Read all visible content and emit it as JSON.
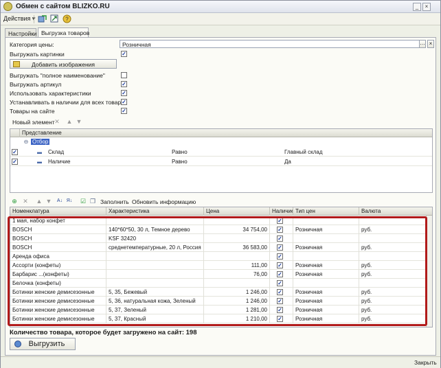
{
  "window": {
    "title": "Обмен с сайтом BLIZKO.RU"
  },
  "toolbar": {
    "actions_label": "Действия ▾"
  },
  "tabs": [
    {
      "label": "Настройки"
    },
    {
      "label": "Выгрузка товаров"
    }
  ],
  "settings": {
    "price_category_label": "Категория цены:",
    "price_category_value": "Розничная",
    "export_images_label": "Выгружать картинки",
    "add_images_button": "Добавить изображения",
    "export_full_name_label": "Выгружать \"полное наименование\"",
    "export_article_label": "Выгружать артикул",
    "use_characteristics_label": "Использовать характеристики",
    "set_in_stock_label": "Устанавливать в наличии для всех товаров",
    "goods_on_site_label": "Товары на сайте"
  },
  "filter": {
    "new_element_label": "Новый элемент",
    "column_header": "Представление",
    "group_label": "Отбор",
    "rows": [
      {
        "field": "Склад",
        "condition": "Равно",
        "value": "Главный склад"
      },
      {
        "field": "Наличие",
        "condition": "Равно",
        "value": "Да"
      }
    ]
  },
  "goods_toolbar": {
    "fill_label": "Заполнить",
    "update_info_label": "Обновить информацию"
  },
  "goods": {
    "columns": [
      "Номенклатура",
      "Характеристика",
      "Цена",
      "Наличие",
      "Тип цен",
      "Валюта"
    ],
    "rows": [
      {
        "name": "1 мая, набор конфет",
        "char": "",
        "price": "",
        "stock": true,
        "price_type": "",
        "currency": ""
      },
      {
        "name": "BOSCH",
        "char": "140*60*50, 30 л, Темное дерево",
        "price": "34 754,00",
        "stock": true,
        "price_type": "Розничная",
        "currency": "руб."
      },
      {
        "name": "BOSCH",
        "char": "KSF 32420",
        "price": "",
        "stock": true,
        "price_type": "",
        "currency": ""
      },
      {
        "name": "BOSCH",
        "char": "среднетемпературные, 20 л, Россия",
        "price": "36 583,00",
        "stock": true,
        "price_type": "Розничная",
        "currency": "руб."
      },
      {
        "name": "Аренда офиса",
        "char": "",
        "price": "",
        "stock": true,
        "price_type": "",
        "currency": ""
      },
      {
        "name": "Ассорти (конфеты)",
        "char": "",
        "price": "111,00",
        "stock": true,
        "price_type": "Розничная",
        "currency": "руб."
      },
      {
        "name": "Барбарис ...(конфеты)",
        "char": "",
        "price": "76,00",
        "stock": true,
        "price_type": "Розничная",
        "currency": "руб."
      },
      {
        "name": "Белочка (конфеты)",
        "char": "",
        "price": "",
        "stock": true,
        "price_type": "",
        "currency": ""
      },
      {
        "name": "Ботинки женские демисезонные",
        "char": "5, 35, Бежевый",
        "price": "1 246,00",
        "stock": true,
        "price_type": "Розничная",
        "currency": "руб."
      },
      {
        "name": "Ботинки женские демисезонные",
        "char": "5, 36, натуральная кожа, Зеленый",
        "price": "1 246,00",
        "stock": true,
        "price_type": "Розничная",
        "currency": "руб."
      },
      {
        "name": "Ботинки женские демисезонные",
        "char": "5, 37, Зеленый",
        "price": "1 281,00",
        "stock": true,
        "price_type": "Розничная",
        "currency": "руб."
      },
      {
        "name": "Ботинки женские демисезонные",
        "char": "5, 37, Красный",
        "price": "1 210,00",
        "stock": true,
        "price_type": "Розничная",
        "currency": "руб."
      }
    ]
  },
  "footer": {
    "count_text": "Количество товара, которое будет загружено на сайт: 198",
    "export_button": "Выгрузить",
    "close_link": "Закрыть"
  },
  "colors": {
    "highlight": "#b11a1a",
    "accent": "#3b63c4"
  }
}
